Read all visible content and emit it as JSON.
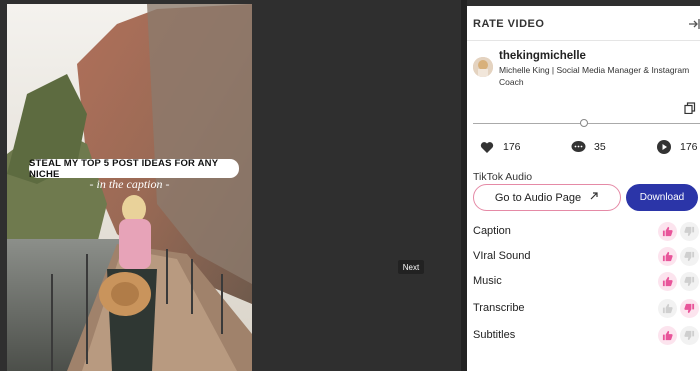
{
  "video": {
    "overlay_title": "STEAL MY TOP 5 POST IDEAS FOR ANY NICHE",
    "overlay_subtitle": "- in the caption -"
  },
  "next_label": "Next",
  "panel": {
    "title": "RATE VIDEO",
    "username": "thekingmichelle",
    "bio": "Michelle King | Social Media Manager & Instagram Coach",
    "stats": {
      "likes": "176",
      "comments": "35",
      "plays": "176"
    },
    "audio_label": "TikTok Audio",
    "audio_button": "Go to Audio Page",
    "download_button": "Download",
    "ratings": [
      {
        "label": "Caption",
        "state": "up"
      },
      {
        "label": "VIral Sound",
        "state": "up"
      },
      {
        "label": "Music",
        "state": "up"
      },
      {
        "label": "Transcribe",
        "state": "down"
      },
      {
        "label": "Subtitles",
        "state": "up"
      }
    ]
  },
  "colors": {
    "accent_pink": "#e8559a",
    "download_blue": "#2b35a8",
    "dark_bg": "#2f2f2f"
  }
}
